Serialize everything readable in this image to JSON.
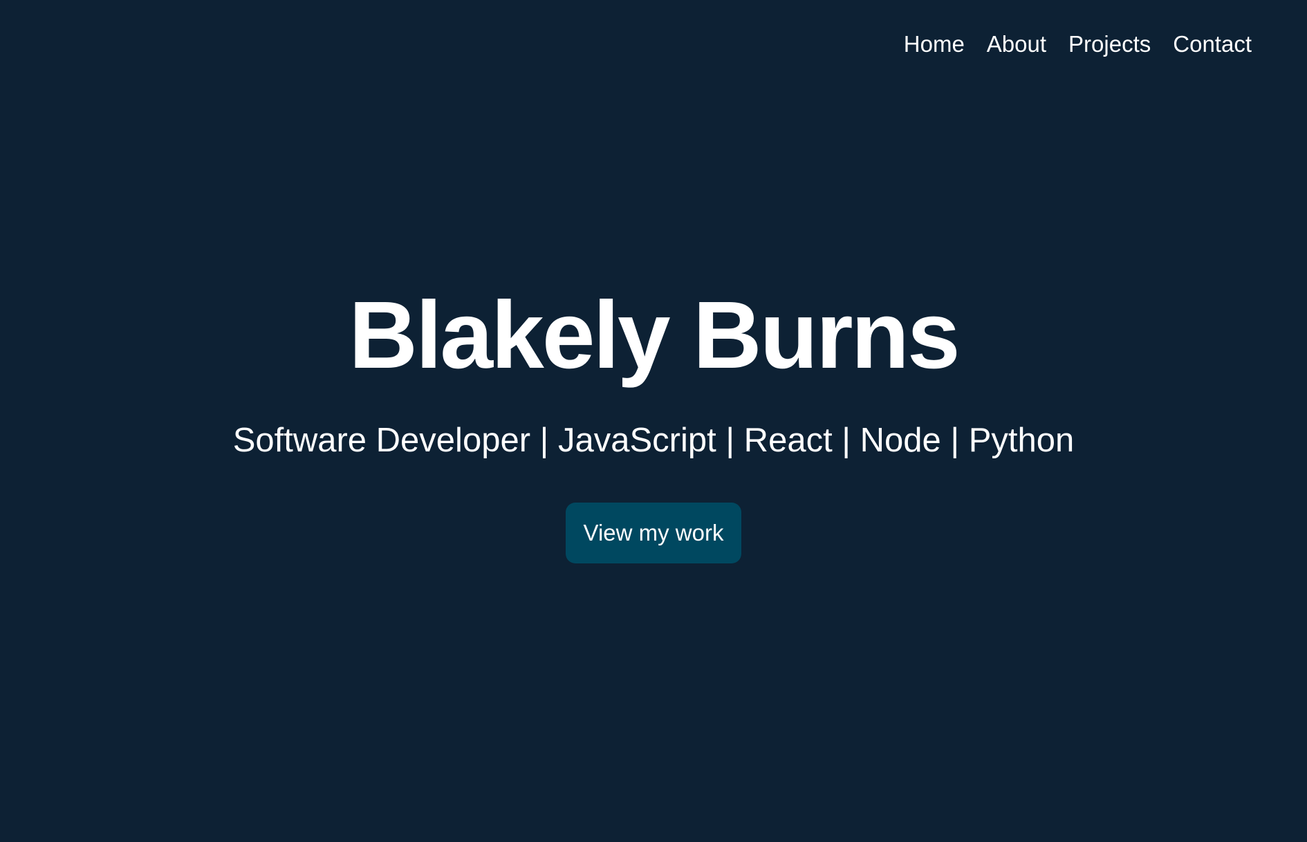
{
  "nav": {
    "items": [
      {
        "label": "Home"
      },
      {
        "label": "About"
      },
      {
        "label": "Projects"
      },
      {
        "label": "Contact"
      }
    ]
  },
  "hero": {
    "title": "Blakely Burns",
    "subtitle": "Software Developer | JavaScript | React | Node | Python",
    "cta_label": "View my work"
  },
  "colors": {
    "background": "#0d2134",
    "text": "#ffffff",
    "button": "#004860"
  }
}
